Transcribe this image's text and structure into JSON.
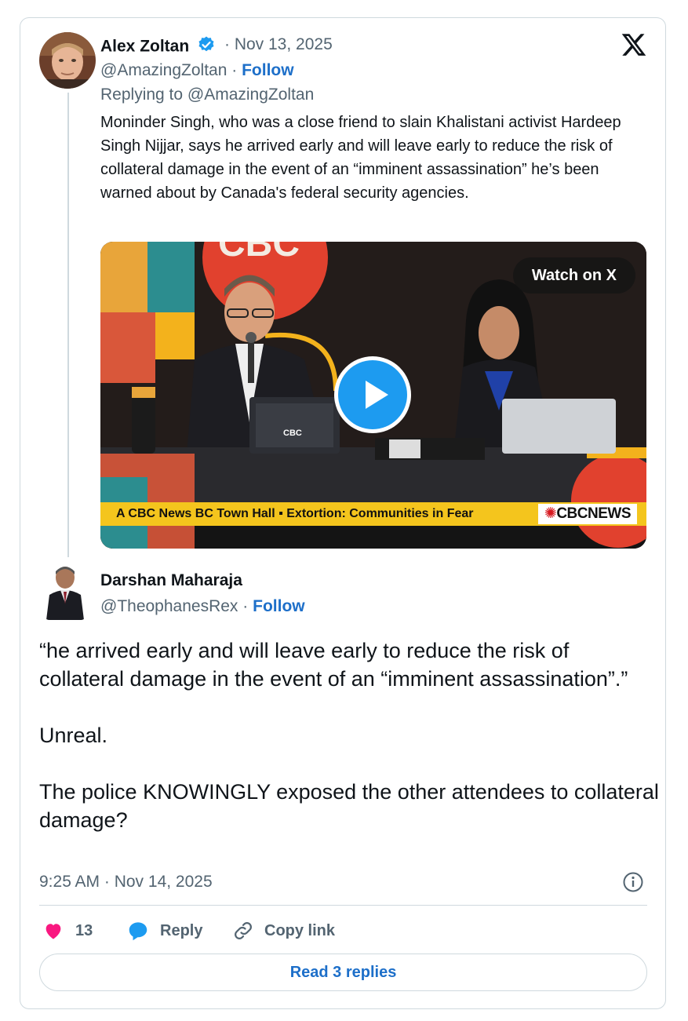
{
  "reply_tweet": {
    "author_name": "Alex Zoltan",
    "date": "· Nov 13, 2025",
    "handle": "@AmazingZoltan",
    "separator": "·",
    "follow_label": "Follow",
    "replying_to": "Replying to @AmazingZoltan",
    "text": "Moninder Singh, who was a close friend to slain Khalistani activist Hardeep Singh Nijjar, says he arrived early and will leave early to reduce the risk of collateral damage in the event of an “imminent assassination” he’s been warned about by Canada's federal security agencies.",
    "video": {
      "watch_label": "Watch on X",
      "ticker_text": "A CBC News BC Town Hall  ▪ Extortion: Communities in Fear",
      "network_label": "CBCNEWS",
      "bg_logo": "CBC",
      "laptop_label": "CBC"
    }
  },
  "main_tweet": {
    "author_name": "Darshan Maharaja",
    "handle": "@TheophanesRex",
    "separator": "·",
    "follow_label": "Follow",
    "text": "“he arrived early and will leave early to reduce the risk of collateral damage in the event of an “imminent assassination”.”\n\nUnreal.\n\nThe police KNOWINGLY exposed the other attendees to collateral damage?",
    "timestamp": "9:25 AM · Nov 14, 2025"
  },
  "actions": {
    "like_count": "13",
    "reply_label": "Reply",
    "copy_link_label": "Copy link",
    "read_replies_label": "Read 3 replies"
  },
  "colors": {
    "link_blue": "#1d6fc9",
    "verified_blue": "#1d9bf0",
    "like_pink": "#f91880",
    "muted_text": "#536471",
    "border": "#cfd9de"
  },
  "icons": [
    "x-logo-icon",
    "verified-badge-icon",
    "play-icon",
    "heart-icon",
    "reply-bubble-icon",
    "link-icon",
    "info-icon"
  ]
}
